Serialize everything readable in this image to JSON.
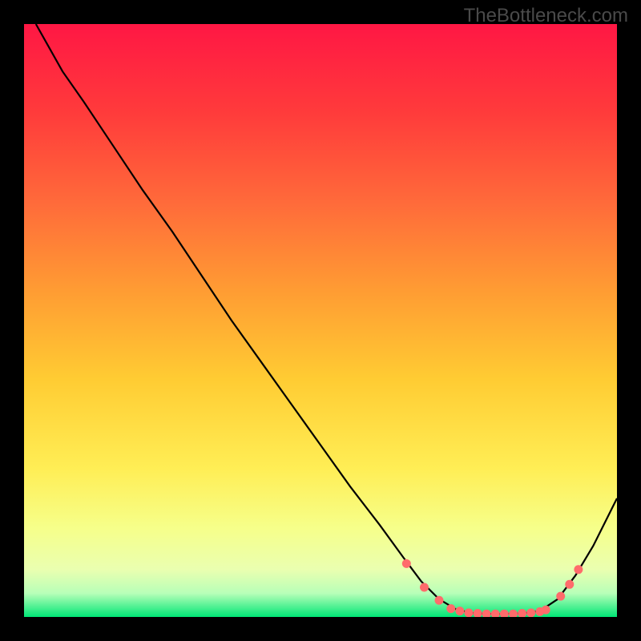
{
  "watermark": "TheBottleneck.com",
  "chart_data": {
    "type": "line",
    "title": "",
    "xlabel": "",
    "ylabel": "",
    "xlim": [
      0,
      100
    ],
    "ylim": [
      0,
      100
    ],
    "background_gradient": {
      "stops": [
        {
          "offset": 0,
          "color": "#ff1744"
        },
        {
          "offset": 15,
          "color": "#ff3b3b"
        },
        {
          "offset": 30,
          "color": "#ff6a3a"
        },
        {
          "offset": 45,
          "color": "#ff9c33"
        },
        {
          "offset": 60,
          "color": "#ffcc33"
        },
        {
          "offset": 75,
          "color": "#ffee55"
        },
        {
          "offset": 85,
          "color": "#f6ff8a"
        },
        {
          "offset": 92,
          "color": "#eaffb0"
        },
        {
          "offset": 96,
          "color": "#b8ffb8"
        },
        {
          "offset": 100,
          "color": "#00e676"
        }
      ]
    },
    "curve": [
      {
        "x": 2.0,
        "y": 100.0
      },
      {
        "x": 6.5,
        "y": 92.0
      },
      {
        "x": 10.0,
        "y": 87.0
      },
      {
        "x": 15.0,
        "y": 79.5
      },
      {
        "x": 20.0,
        "y": 72.0
      },
      {
        "x": 25.0,
        "y": 65.0
      },
      {
        "x": 30.0,
        "y": 57.5
      },
      {
        "x": 35.0,
        "y": 50.0
      },
      {
        "x": 40.0,
        "y": 43.0
      },
      {
        "x": 45.0,
        "y": 36.0
      },
      {
        "x": 50.0,
        "y": 29.0
      },
      {
        "x": 55.0,
        "y": 22.0
      },
      {
        "x": 60.0,
        "y": 15.5
      },
      {
        "x": 64.0,
        "y": 10.0
      },
      {
        "x": 67.0,
        "y": 6.0
      },
      {
        "x": 70.0,
        "y": 3.0
      },
      {
        "x": 73.0,
        "y": 1.2
      },
      {
        "x": 76.0,
        "y": 0.6
      },
      {
        "x": 80.0,
        "y": 0.5
      },
      {
        "x": 84.0,
        "y": 0.6
      },
      {
        "x": 87.0,
        "y": 1.0
      },
      {
        "x": 90.0,
        "y": 3.0
      },
      {
        "x": 93.0,
        "y": 7.0
      },
      {
        "x": 96.0,
        "y": 12.0
      },
      {
        "x": 100.0,
        "y": 20.0
      }
    ],
    "markers": [
      {
        "x": 64.5,
        "y": 9.0
      },
      {
        "x": 67.5,
        "y": 5.0
      },
      {
        "x": 70.0,
        "y": 2.8
      },
      {
        "x": 72.0,
        "y": 1.4
      },
      {
        "x": 73.5,
        "y": 1.0
      },
      {
        "x": 75.0,
        "y": 0.7
      },
      {
        "x": 76.5,
        "y": 0.6
      },
      {
        "x": 78.0,
        "y": 0.5
      },
      {
        "x": 79.5,
        "y": 0.5
      },
      {
        "x": 81.0,
        "y": 0.5
      },
      {
        "x": 82.5,
        "y": 0.5
      },
      {
        "x": 84.0,
        "y": 0.6
      },
      {
        "x": 85.5,
        "y": 0.7
      },
      {
        "x": 87.0,
        "y": 0.9
      },
      {
        "x": 88.0,
        "y": 1.2
      },
      {
        "x": 90.5,
        "y": 3.5
      },
      {
        "x": 92.0,
        "y": 5.5
      },
      {
        "x": 93.5,
        "y": 8.0
      }
    ],
    "curve_color": "#000000",
    "marker_color": "#ff6b6b"
  }
}
